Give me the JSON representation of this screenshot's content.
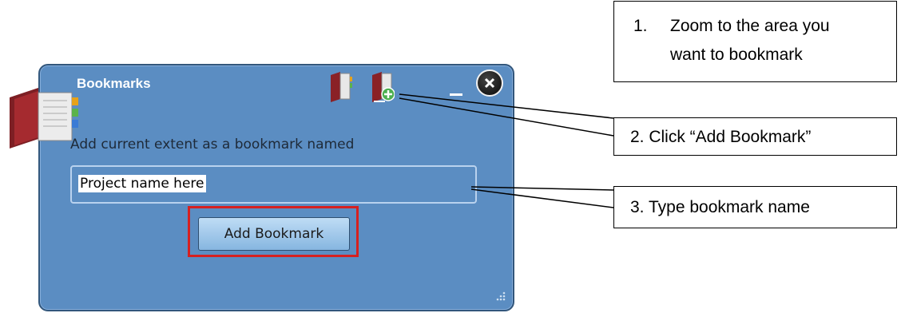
{
  "widget": {
    "title": "Bookmarks",
    "instruction": "Add current extent as a bookmark named",
    "input_value": "Project name here",
    "add_button_label": "Add Bookmark",
    "icons": [
      "bookmarks-book-icon",
      "bookmark-list-icon",
      "add-bookmark-icon",
      "minimize-icon",
      "close-icon",
      "resize-grip-icon"
    ],
    "colors": {
      "panel": "#5b8dc2",
      "border": "#33577c",
      "highlight": "#d62020"
    }
  },
  "callouts": {
    "step1_number": "1.",
    "step1_line1": "Zoom to the area you",
    "step1_line2": "want to bookmark",
    "step2": "2. Click “Add Bookmark”",
    "step3": "3. Type bookmark name"
  }
}
